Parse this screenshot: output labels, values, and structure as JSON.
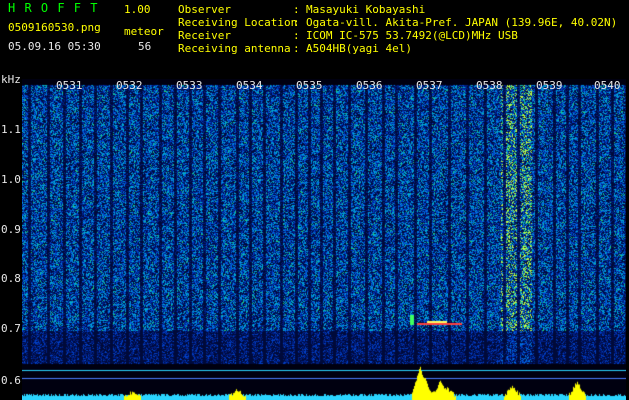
{
  "app": {
    "title": "H R O F F T",
    "version": "1.00",
    "filename": "0509160530.png",
    "mode": "meteor",
    "datetime": "05.09.16 05:30",
    "count": "56"
  },
  "station": {
    "observer_label": "Observer",
    "observer": "Masayuki Kobayashi",
    "location_label": "Receiving Location",
    "location": "Ogata-vill. Akita-Pref. JAPAN (139.96E, 40.02N)",
    "receiver_label": "Receiver",
    "receiver": "ICOM IC-575 53.7492(@LCD)MHz USB",
    "antenna_label": "Receiving antenna",
    "antenna": "A504HB(yagi 4el)",
    "sep": ":"
  },
  "axis": {
    "unit": "kHz",
    "y_ticks": [
      "1.1",
      "1.0",
      "0.9",
      "0.8",
      "0.7",
      "0.6"
    ],
    "time_ticks": [
      "0531",
      "0532",
      "0533",
      "0534",
      "0535",
      "0536",
      "0537",
      "0538",
      "0539",
      "0540"
    ]
  },
  "colors": {
    "text_green": "#00ff00",
    "text_yellow": "#ffff00",
    "text_white": "#e8e8e8",
    "marker_yellow": "#ffff00",
    "baseline_cyan": "#2ad4ff"
  }
}
